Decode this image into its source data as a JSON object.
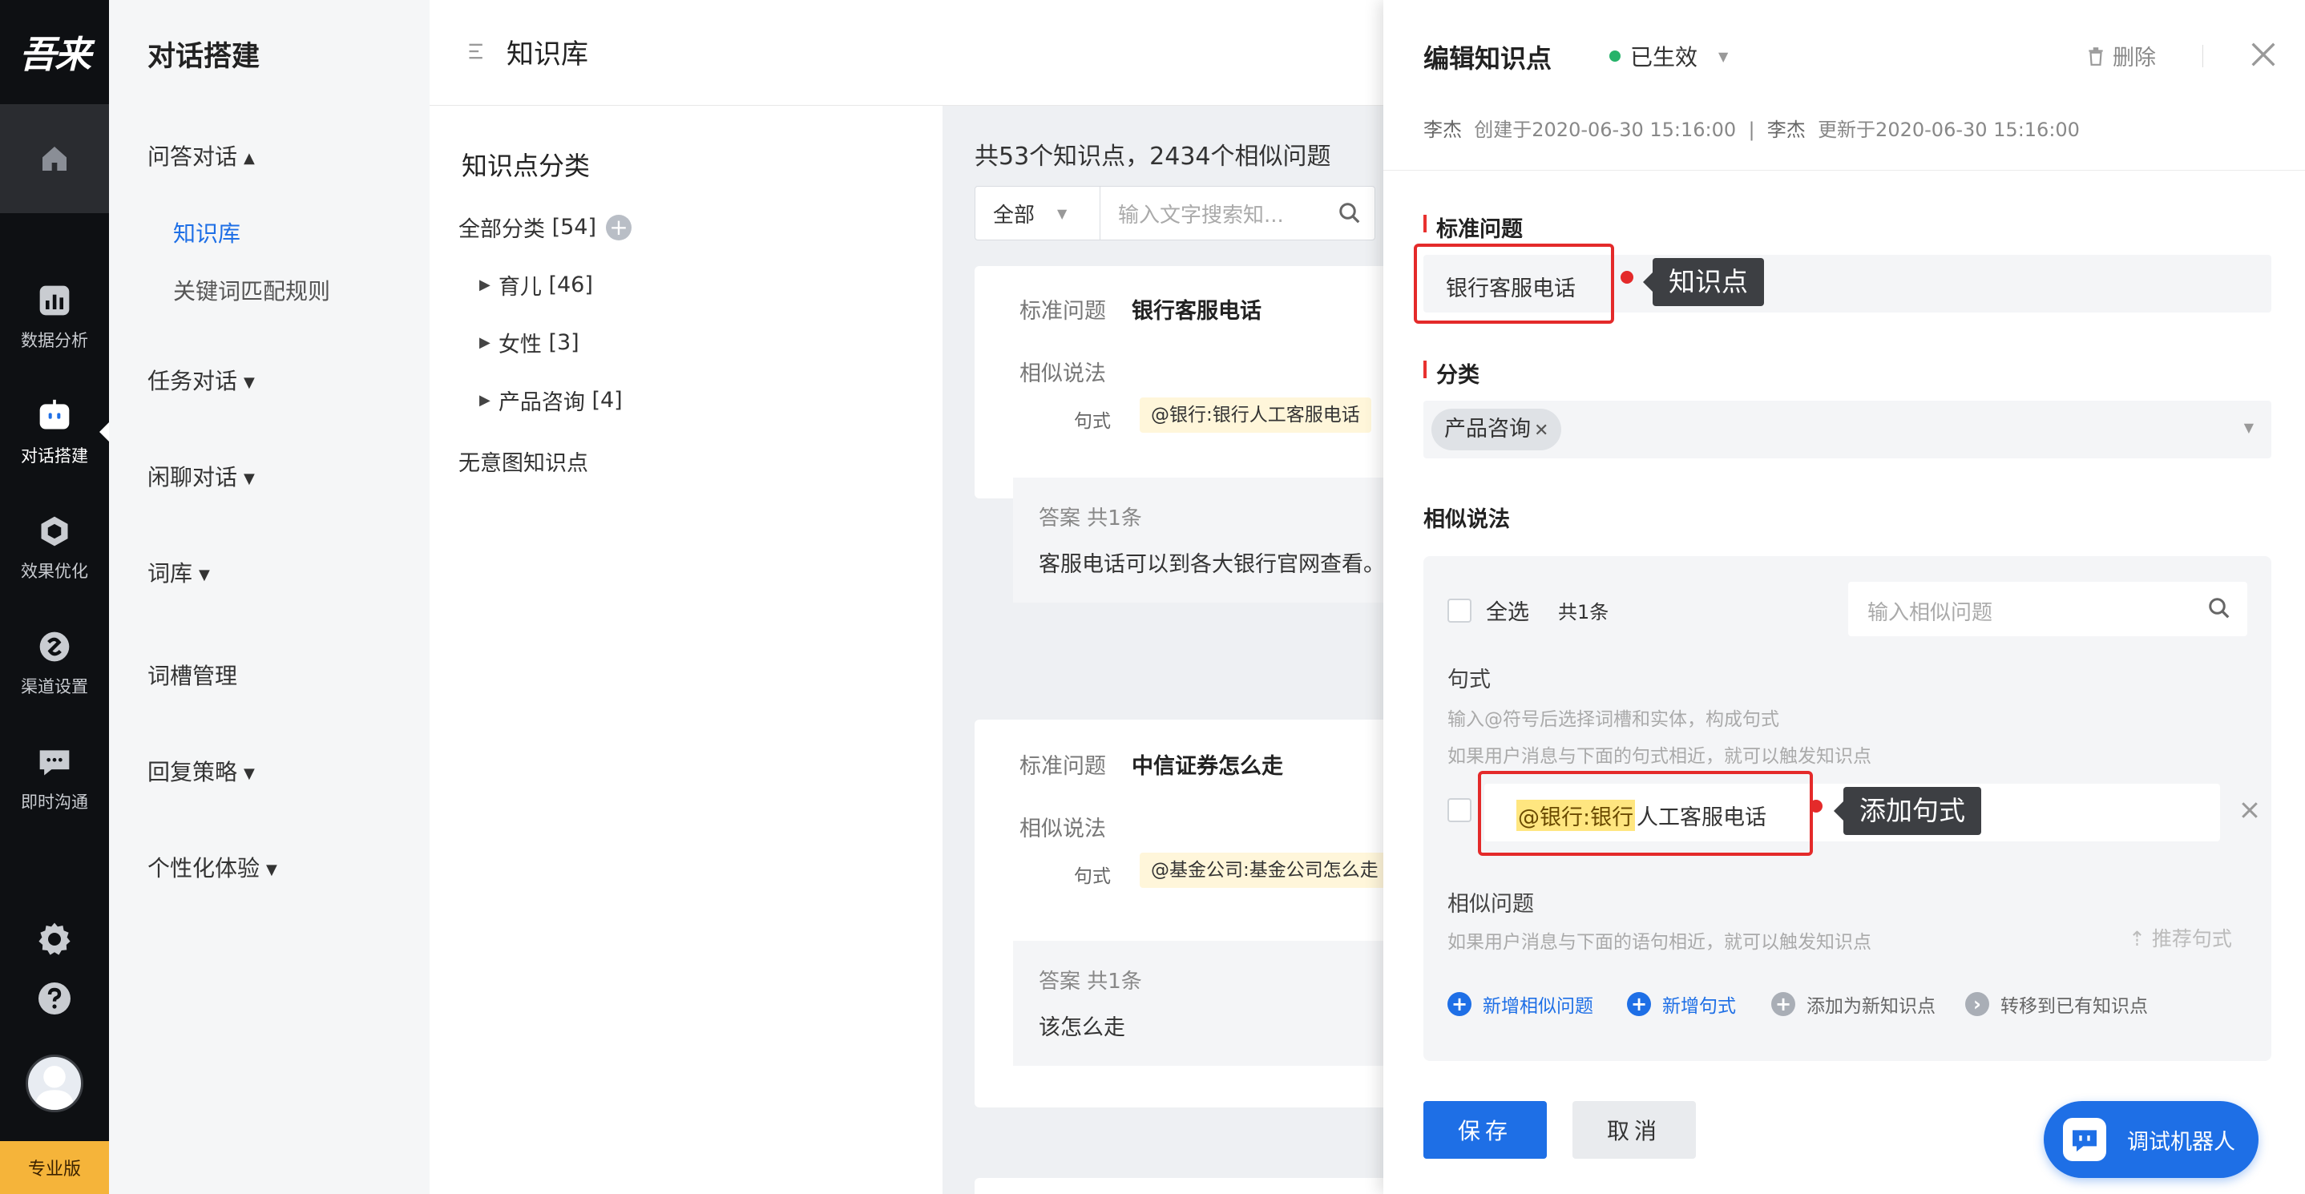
{
  "rail": {
    "logo": "吾来",
    "items": [
      {
        "label": "数据分析",
        "icon": "chart-icon"
      },
      {
        "label": "对话搭建",
        "icon": "robot-icon"
      },
      {
        "label": "效果优化",
        "icon": "cube-icon"
      },
      {
        "label": "渠道设置",
        "icon": "channel-icon"
      },
      {
        "label": "即时沟通",
        "icon": "chat-icon"
      }
    ],
    "edition": "专业版"
  },
  "nav2": {
    "title": "对话搭建",
    "qa": "问答对话",
    "kb": "知识库",
    "keyword": "关键词匹配规则",
    "task": "任务对话",
    "chitchat": "闲聊对话",
    "lexicon": "词库",
    "slots": "词槽管理",
    "reply": "回复策略",
    "personal": "个性化体验"
  },
  "topbar": {
    "title": "知识库"
  },
  "categories": {
    "title": "知识点分类",
    "all": "全部分类",
    "all_count": "[54]",
    "items": [
      {
        "name": "育儿",
        "count": "[46]"
      },
      {
        "name": "女性",
        "count": "[3]"
      },
      {
        "name": "产品咨询",
        "count": "[4]"
      }
    ],
    "no_intent": "无意图知识点"
  },
  "list": {
    "summary": "共53个知识点，2434个相似问题",
    "filter_value": "全部",
    "search_placeholder": "输入文字搜索知...",
    "cards": [
      {
        "std_label": "标准问题",
        "std_q": "银行客服电话",
        "sim_label": "相似说法",
        "pat_label": "句式",
        "pattern": "@银行:银行人工客服电话",
        "ans_label": "答案  共1条",
        "answer": "客服电话可以到各大银行官网查看。"
      },
      {
        "std_label": "标准问题",
        "std_q": "中信证券怎么走",
        "sim_label": "相似说法",
        "pat_label": "句式",
        "pattern": "@基金公司:基金公司怎么走",
        "ans_label": "答案  共1条",
        "answer": "该怎么走"
      }
    ]
  },
  "drawer": {
    "title": "编辑知识点",
    "status": "已生效",
    "delete": "删除",
    "meta_creator": "李杰",
    "meta_created": "创建于2020-06-30 15:16:00",
    "meta_sep": "|",
    "meta_updater": "李杰",
    "meta_updated": "更新于2020-06-30 15:16:00",
    "std_label": "标准问题",
    "std_value": "银行客服电话",
    "callout_kp": "知识点",
    "cat_label": "分类",
    "cat_tag": "产品咨询",
    "sim_label": "相似说法",
    "select_all": "全选",
    "sim_count": "共1条",
    "sim_search_placeholder": "输入相似问题",
    "pattern_title": "句式",
    "pattern_hint1": "输入@符号后选择词槽和实体，构成句式",
    "pattern_hint2": "如果用户消息与下面的句式相近，就可以触发知识点",
    "pattern_entity": "@银行:银行",
    "pattern_rest": "人工客服电话",
    "callout_pattern": "添加句式",
    "simq_title": "相似问题",
    "simq_hint": "如果用户消息与下面的语句相近，就可以触发知识点",
    "recommend": "推荐句式",
    "actions": [
      "新增相似问题",
      "新增句式",
      "添加为新知识点",
      "转移到已有知识点"
    ],
    "save": "保存",
    "cancel": "取消",
    "robot": "调试机器人"
  },
  "colors": {
    "accent": "#1e6fe6",
    "active_status": "#26b36a",
    "annotation": "#e42a2a",
    "pro_badge": "#f5b43a"
  }
}
